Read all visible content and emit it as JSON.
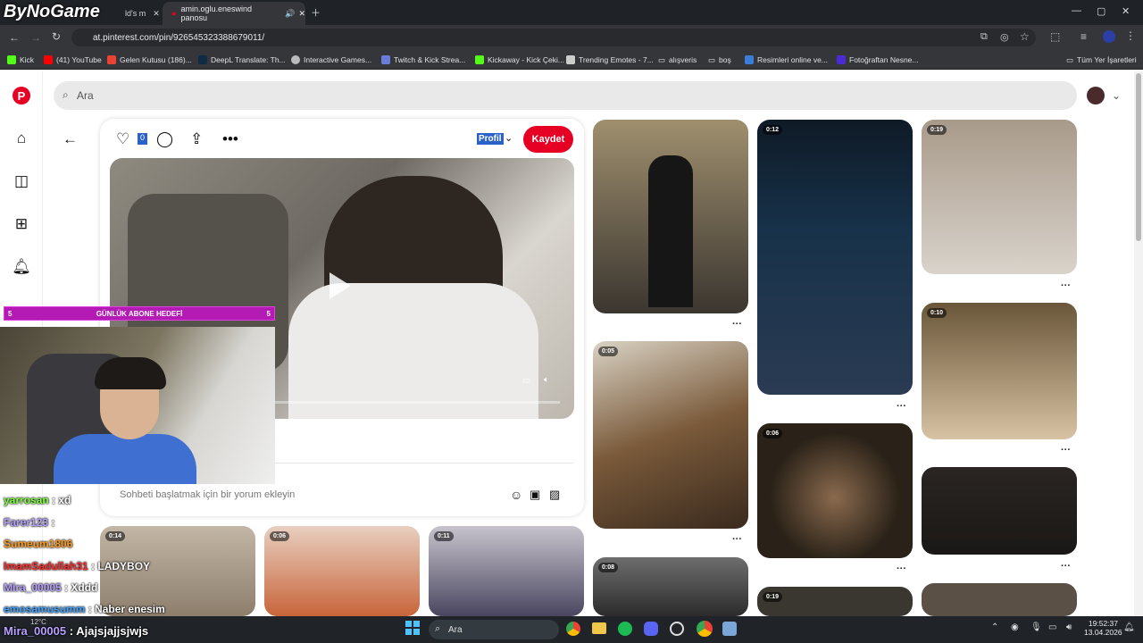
{
  "browser": {
    "tabs": [
      {
        "title": "ld's m",
        "active": false
      },
      {
        "title": "amin.oglu.eneswind panosu",
        "active": true
      }
    ],
    "url": "at.pinterest.com/pin/926545323388679011/",
    "bookmarks": [
      "Kick",
      "(41) YouTube",
      "Gelen Kutusu (186)...",
      "DeepL Translate: Th...",
      "Interactive Games...",
      "Twitch & Kick Strea...",
      "Kickaway - Kick Çeki...",
      "Trending Emotes - 7...",
      "alışveris",
      "boş",
      "Resimleri online ve...",
      "Fotoğraftan Nesne...",
      "Tüm Yer İşaretleri"
    ]
  },
  "pinterest": {
    "search_placeholder": "Ara",
    "like_count": "0",
    "profile_label": "Profil",
    "save_label": "Kaydet",
    "comment_placeholder": "Sohbeti başlatmak için bir yorum ekleyin",
    "durations": {
      "c2_1": "0:12",
      "c3_1": "0:19",
      "c1_2": "0:05",
      "c3_2": "0:10",
      "c2_2": "0:06",
      "c1_3": "0:08",
      "c2_3": "0:19",
      "b1": "0:14",
      "b2": "0:06",
      "b3": "0:11"
    }
  },
  "stream": {
    "logo": "ByNoGame",
    "goal": {
      "left": "5",
      "label": "GÜNLÜK ABONE HEDEFİ",
      "right": "5"
    },
    "chat": [
      {
        "user": "yarrosan",
        "msg": ": xd",
        "color": "#7cff3a"
      },
      {
        "user": "Farer123",
        "msg": ":",
        "color": "#b7a1ff"
      },
      {
        "user": "Sumeum1806",
        "msg": "",
        "color": "#ff9a1a"
      },
      {
        "user": "ImamSadullah31",
        "msg": ": LADYBOY",
        "color": "#ff2a2a"
      },
      {
        "user": "Mira_00005",
        "msg": ": Xddd",
        "color": "#b7a1ff"
      },
      {
        "user": "emosamusumm",
        "msg": ": Naber enesim",
        "color": "#3aa0ff"
      },
      {
        "user": "Mira_00005",
        "msg": ": Ajajsjajjsjwjs",
        "color": "#b7a1ff"
      }
    ]
  },
  "taskbar": {
    "weather": "12°C",
    "search": "Ara",
    "time": "19:52:37",
    "date": "13.04.2026"
  },
  "colors": {
    "save": "#e60023",
    "goal": "#b41bb4",
    "taskbar": "#202428"
  }
}
